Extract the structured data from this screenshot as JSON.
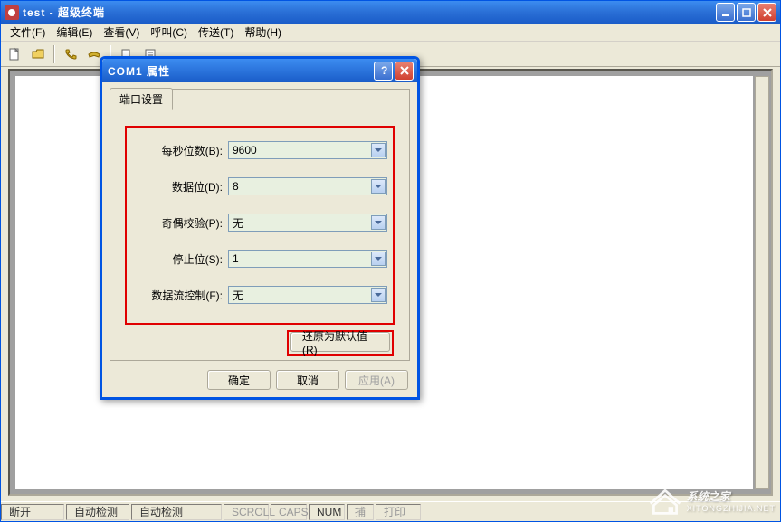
{
  "main_window": {
    "title": "test - 超级终端",
    "menu": {
      "file": "文件(F)",
      "edit": "编辑(E)",
      "view": "查看(V)",
      "call": "呼叫(C)",
      "transfer": "传送(T)",
      "help": "帮助(H)"
    },
    "status": {
      "disconnected": "断开",
      "auto_detect_1": "自动检测",
      "auto_detect_2": "自动检测",
      "scroll": "SCROLL",
      "caps": "CAPS",
      "num": "NUM",
      "capture": "捕",
      "print": "打印"
    }
  },
  "dialog": {
    "title": "COM1 属性",
    "tab_label": "端口设置",
    "fields": {
      "baud": {
        "label": "每秒位数(B):",
        "value": "9600"
      },
      "databits": {
        "label": "数据位(D):",
        "value": "8"
      },
      "parity": {
        "label": "奇偶校验(P):",
        "value": "无"
      },
      "stopbits": {
        "label": "停止位(S):",
        "value": "1"
      },
      "flowctrl": {
        "label": "数据流控制(F):",
        "value": "无"
      }
    },
    "buttons": {
      "restore": "还原为默认值(R)",
      "ok": "确定",
      "cancel": "取消",
      "apply": "应用(A)"
    }
  },
  "watermark": {
    "text": "系统之家",
    "sub": "XITONGZHIJIA.NET"
  }
}
